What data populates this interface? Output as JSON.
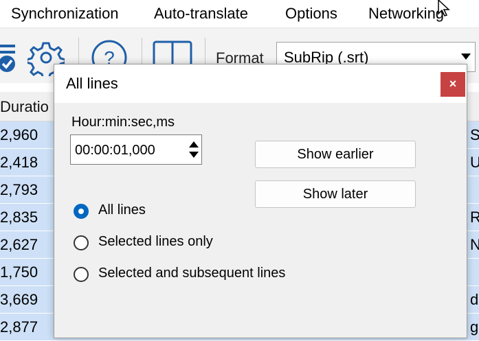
{
  "menubar": {
    "items": [
      "Synchronization",
      "Auto-translate",
      "Options",
      "Networking"
    ]
  },
  "toolbar": {
    "icons": [
      "checklist-icon",
      "gear-icon",
      "help-icon",
      "layout-icon"
    ],
    "format_label": "Format",
    "format_value": "SubRip (.srt)"
  },
  "grid": {
    "header_label": "Duratio",
    "rows": [
      {
        "duration": "2,960",
        "text_fragment": "S"
      },
      {
        "duration": "2,418",
        "text_fragment": "U"
      },
      {
        "duration": "2,793",
        "text_fragment": ""
      },
      {
        "duration": "2,835",
        "text_fragment": "R"
      },
      {
        "duration": "2,627",
        "text_fragment": "N"
      },
      {
        "duration": "1,750",
        "text_fragment": ""
      },
      {
        "duration": "3,669",
        "text_fragment": "d"
      },
      {
        "duration": "2,877",
        "text_fragment": "g"
      }
    ]
  },
  "dialog": {
    "title": "All lines",
    "close_label": "×",
    "time_label": "Hour:min:sec,ms",
    "time_value": "00:00:01,000",
    "show_earlier_label": "Show earlier",
    "show_later_label": "Show later",
    "radio_options": [
      {
        "label": "All lines",
        "checked": true
      },
      {
        "label": "Selected lines only",
        "checked": false
      },
      {
        "label": "Selected and subsequent lines",
        "checked": false
      }
    ]
  },
  "colors": {
    "accent": "#0067c0",
    "close_button": "#c74242",
    "grid_row": "#cde0f7"
  }
}
